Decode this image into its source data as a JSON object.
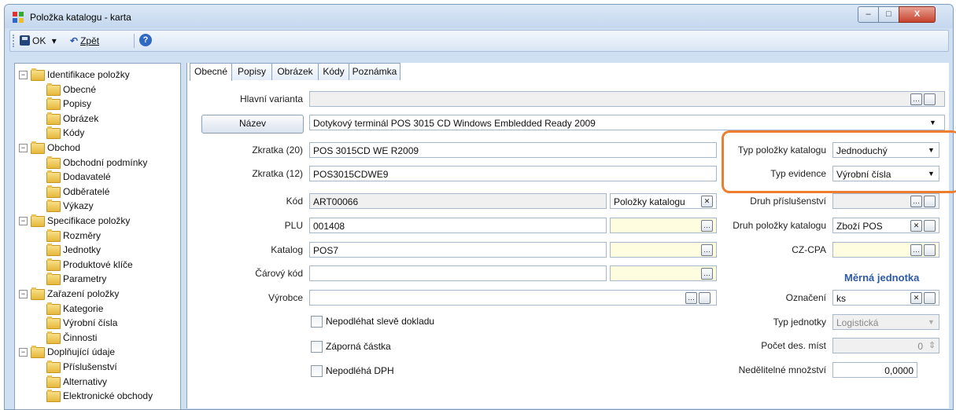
{
  "window": {
    "title": "Položka katalogu - karta",
    "controls": {
      "min": "–",
      "max": "□",
      "close": "X"
    }
  },
  "toolbar": {
    "ok": "OK",
    "ok_arrow": "▾",
    "back": "Zpět",
    "back_arrow": "↶",
    "help": "?"
  },
  "tree": {
    "items": [
      {
        "label": "Identifikace položky",
        "expander": "−"
      },
      {
        "label": "Obecné"
      },
      {
        "label": "Popisy"
      },
      {
        "label": "Obrázek"
      },
      {
        "label": "Kódy"
      },
      {
        "label": "Obchod",
        "expander": "−"
      },
      {
        "label": "Obchodní podmínky"
      },
      {
        "label": "Dodavatelé"
      },
      {
        "label": "Odběratelé"
      },
      {
        "label": "Výkazy"
      },
      {
        "label": "Specifikace položky",
        "expander": "−"
      },
      {
        "label": "Rozměry"
      },
      {
        "label": "Jednotky"
      },
      {
        "label": "Produktové klíče"
      },
      {
        "label": "Parametry"
      },
      {
        "label": "Zařazení položky",
        "expander": "−"
      },
      {
        "label": "Kategorie"
      },
      {
        "label": "Výrobní čísla"
      },
      {
        "label": "Činnosti"
      },
      {
        "label": "Doplňující údaje",
        "expander": "−"
      },
      {
        "label": "Příslušenství"
      },
      {
        "label": "Alternativy"
      },
      {
        "label": "Elektronické obchody"
      }
    ]
  },
  "tabs": [
    "Obecné",
    "Popisy",
    "Obrázek",
    "Kódy",
    "Poznámka"
  ],
  "form": {
    "hlavni_varianta": {
      "label": "Hlavní varianta",
      "value": ""
    },
    "nazev": {
      "button": "Název",
      "value": "Dotykový terminál POS 3015 CD Windows Embledded Ready 2009"
    },
    "zkratka20": {
      "label": "Zkratka (20)",
      "value": "POS 3015CD WE R2009"
    },
    "zkratka12": {
      "label": "Zkratka (12)",
      "value": "POS3015CDWE9"
    },
    "kod": {
      "label": "Kód",
      "value": "ART00066",
      "series": "Položky katalogu"
    },
    "plu": {
      "label": "PLU",
      "value": "001408"
    },
    "katalog": {
      "label": "Katalog",
      "value": "POS7"
    },
    "carovy_kod": {
      "label": "Čárový kód",
      "value": ""
    },
    "vyrobce": {
      "label": "Výrobce",
      "value": ""
    },
    "check1": "Nepodléhat slevě dokladu",
    "check2": "Záporná částka",
    "check3": "Nepodléhá DPH"
  },
  "right": {
    "typ_polozky": {
      "label": "Typ položky katalogu",
      "value": "Jednoduchý"
    },
    "typ_evidence": {
      "label": "Typ evidence",
      "value": "Výrobní čísla"
    },
    "druh_prislusenstvi": {
      "label": "Druh příslušenství",
      "value": ""
    },
    "druh_polozky": {
      "label": "Druh položky katalogu",
      "value": "Zboží POS"
    },
    "cz_cpa": {
      "label": "CZ-CPA",
      "value": ""
    },
    "mj_title": "Měrná jednotka",
    "oznaceni": {
      "label": "Označení",
      "value": "ks"
    },
    "typ_jednotky": {
      "label": "Typ jednotky",
      "value": "Logistická"
    },
    "pocet_des": {
      "label": "Počet des. míst",
      "value": "0"
    },
    "nedelitelne": {
      "label": "Nedělitelné množství",
      "value": "0,0000"
    }
  },
  "glyphs": {
    "dots": "…",
    "x": "✕",
    "arrow_down": "▼",
    "spin": "⇕"
  }
}
